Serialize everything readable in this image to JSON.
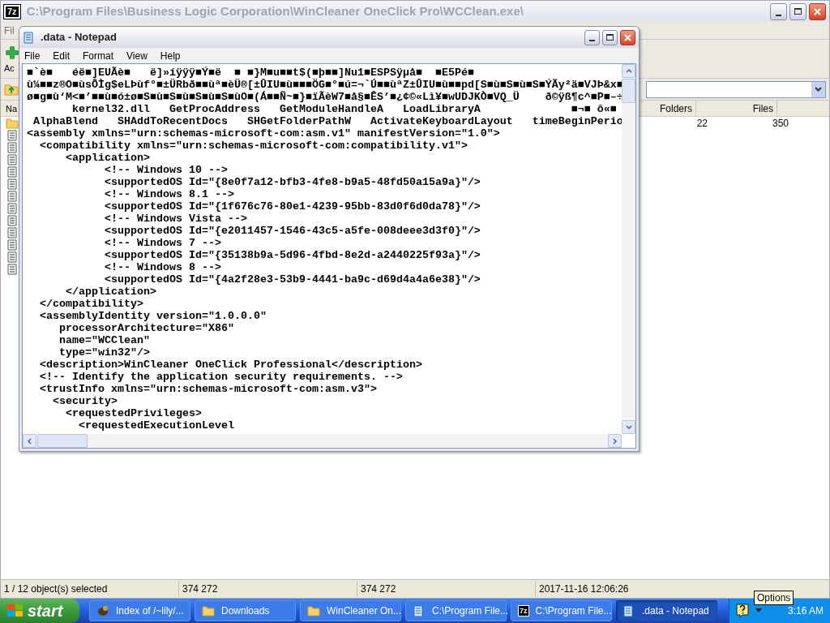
{
  "archive_window": {
    "icon_text": "7z",
    "title": "C:\\Program Files\\Business Logic Corporation\\WinCleaner OneClick Pro\\WCClean.exe\\",
    "menu": [
      "Fil"
    ],
    "toolbar": [
      {
        "label": "Ac"
      }
    ],
    "columns": [
      "Na",
      "Folders",
      "Files"
    ],
    "rows": [
      {
        "kind": "folder",
        "folders": "22",
        "files": "350"
      },
      {
        "kind": "file"
      },
      {
        "kind": "file"
      },
      {
        "kind": "file"
      },
      {
        "kind": "file"
      },
      {
        "kind": "file"
      },
      {
        "kind": "file"
      },
      {
        "kind": "file"
      },
      {
        "kind": "file"
      },
      {
        "kind": "file"
      },
      {
        "kind": "file"
      },
      {
        "kind": "file"
      },
      {
        "kind": "file"
      }
    ],
    "status_bar": [
      "1 / 12 object(s) selected",
      "374 272",
      "374 272",
      "2017-11-16 12:06:26"
    ]
  },
  "notepad": {
    "title": ".data - Notepad",
    "menu": [
      "File",
      "Edit",
      "Format",
      "View",
      "Help"
    ],
    "lines": [
      "■`è■   éë■]EUÃè■   ë]»íÿÿÿ■Ý■ë  ■ ■}M■u■■t$(■þ■■]Nu1■ESPSÿµå■  ■E5Pé■",
      "ù¼■■z®O■ùsÔÌg$eLÞùf°■±ÜRbð■■ùª■èÜ®[±ÛIU■ù■■■ÖG■°■ú=¬`Ú■■ùªZ±ÛIU■ù■■pd[S■ù■S■ù■S■ÝÃy²ä■VJÞ&x■",
      "ø■g■ù‘M<■’■■ù■ó±ø■S■ù■S■ù■S■ù■S■ùO■(Á■■Ñ~■}■ïÃèW7■å§■ÊS’■¿¢©«Lì¥■wUDJKÒ■VQ_Ü    ð©ÿß¶c^■P■–÷",
      "       kernel32.dll   GetProcAddress   GetModuleHandleA   LoadLibraryA              ■¬■ ô«■",
      " AlphaBlend   SHAddToRecentDocs   SHGetFolderPathW   ActivateKeyboardLayout   timeBeginPerio",
      "<assembly xmlns=\"urn:schemas-microsoft-com:asm.v1\" manifestVersion=\"1.0\">",
      "  <compatibility xmlns=\"urn:schemas-microsoft-com:compatibility.v1\">",
      "      <application>",
      "            <!-- Windows 10 -->",
      "            <supportedOS Id=\"{8e0f7a12-bfb3-4fe8-b9a5-48fd50a15a9a}\"/>",
      "            <!-- Windows 8.1 -->",
      "            <supportedOS Id=\"{1f676c76-80e1-4239-95bb-83d0f6d0da78}\"/>",
      "            <!-- Windows Vista -->",
      "            <supportedOS Id=\"{e2011457-1546-43c5-a5fe-008deee3d3f0}\"/>",
      "            <!-- Windows 7 -->",
      "            <supportedOS Id=\"{35138b9a-5d96-4fbd-8e2d-a2440225f93a}\"/>",
      "            <!-- Windows 8 -->",
      "            <supportedOS Id=\"{4a2f28e3-53b9-4441-ba9c-d69d4a4a6e38}\"/>",
      "      </application>",
      "  </compatibility>",
      "  <assemblyIdentity version=\"1.0.0.0\"",
      "     processorArchitecture=\"X86\"",
      "     name=\"WCClean\"",
      "     type=\"win32\"/>",
      "  <description>WinCleaner OneClick Professional</description>",
      "  <!-- Identify the application security requirements. -->",
      "  <trustInfo xmlns=\"urn:schemas-microsoft-com:asm.v3\">",
      "    <security>",
      "      <requestedPrivileges>",
      "        <requestedExecutionLevel"
    ]
  },
  "taskbar": {
    "start": "start",
    "buttons": [
      {
        "kind": "browser",
        "label": "Index of /~lily/...",
        "selected": false
      },
      {
        "kind": "folder",
        "label": "Downloads",
        "selected": false
      },
      {
        "kind": "folder",
        "label": "WinCleaner On...",
        "selected": false
      },
      {
        "kind": "notepad",
        "label": "C:\\Program File...",
        "selected": false
      },
      {
        "kind": "archive",
        "icon_text": "7z",
        "label": "C:\\Program File...",
        "selected": false
      },
      {
        "kind": "notepad",
        "label": ".data - Notepad",
        "selected": true
      }
    ],
    "tooltip": "Options",
    "clock": "3:16 AM"
  }
}
